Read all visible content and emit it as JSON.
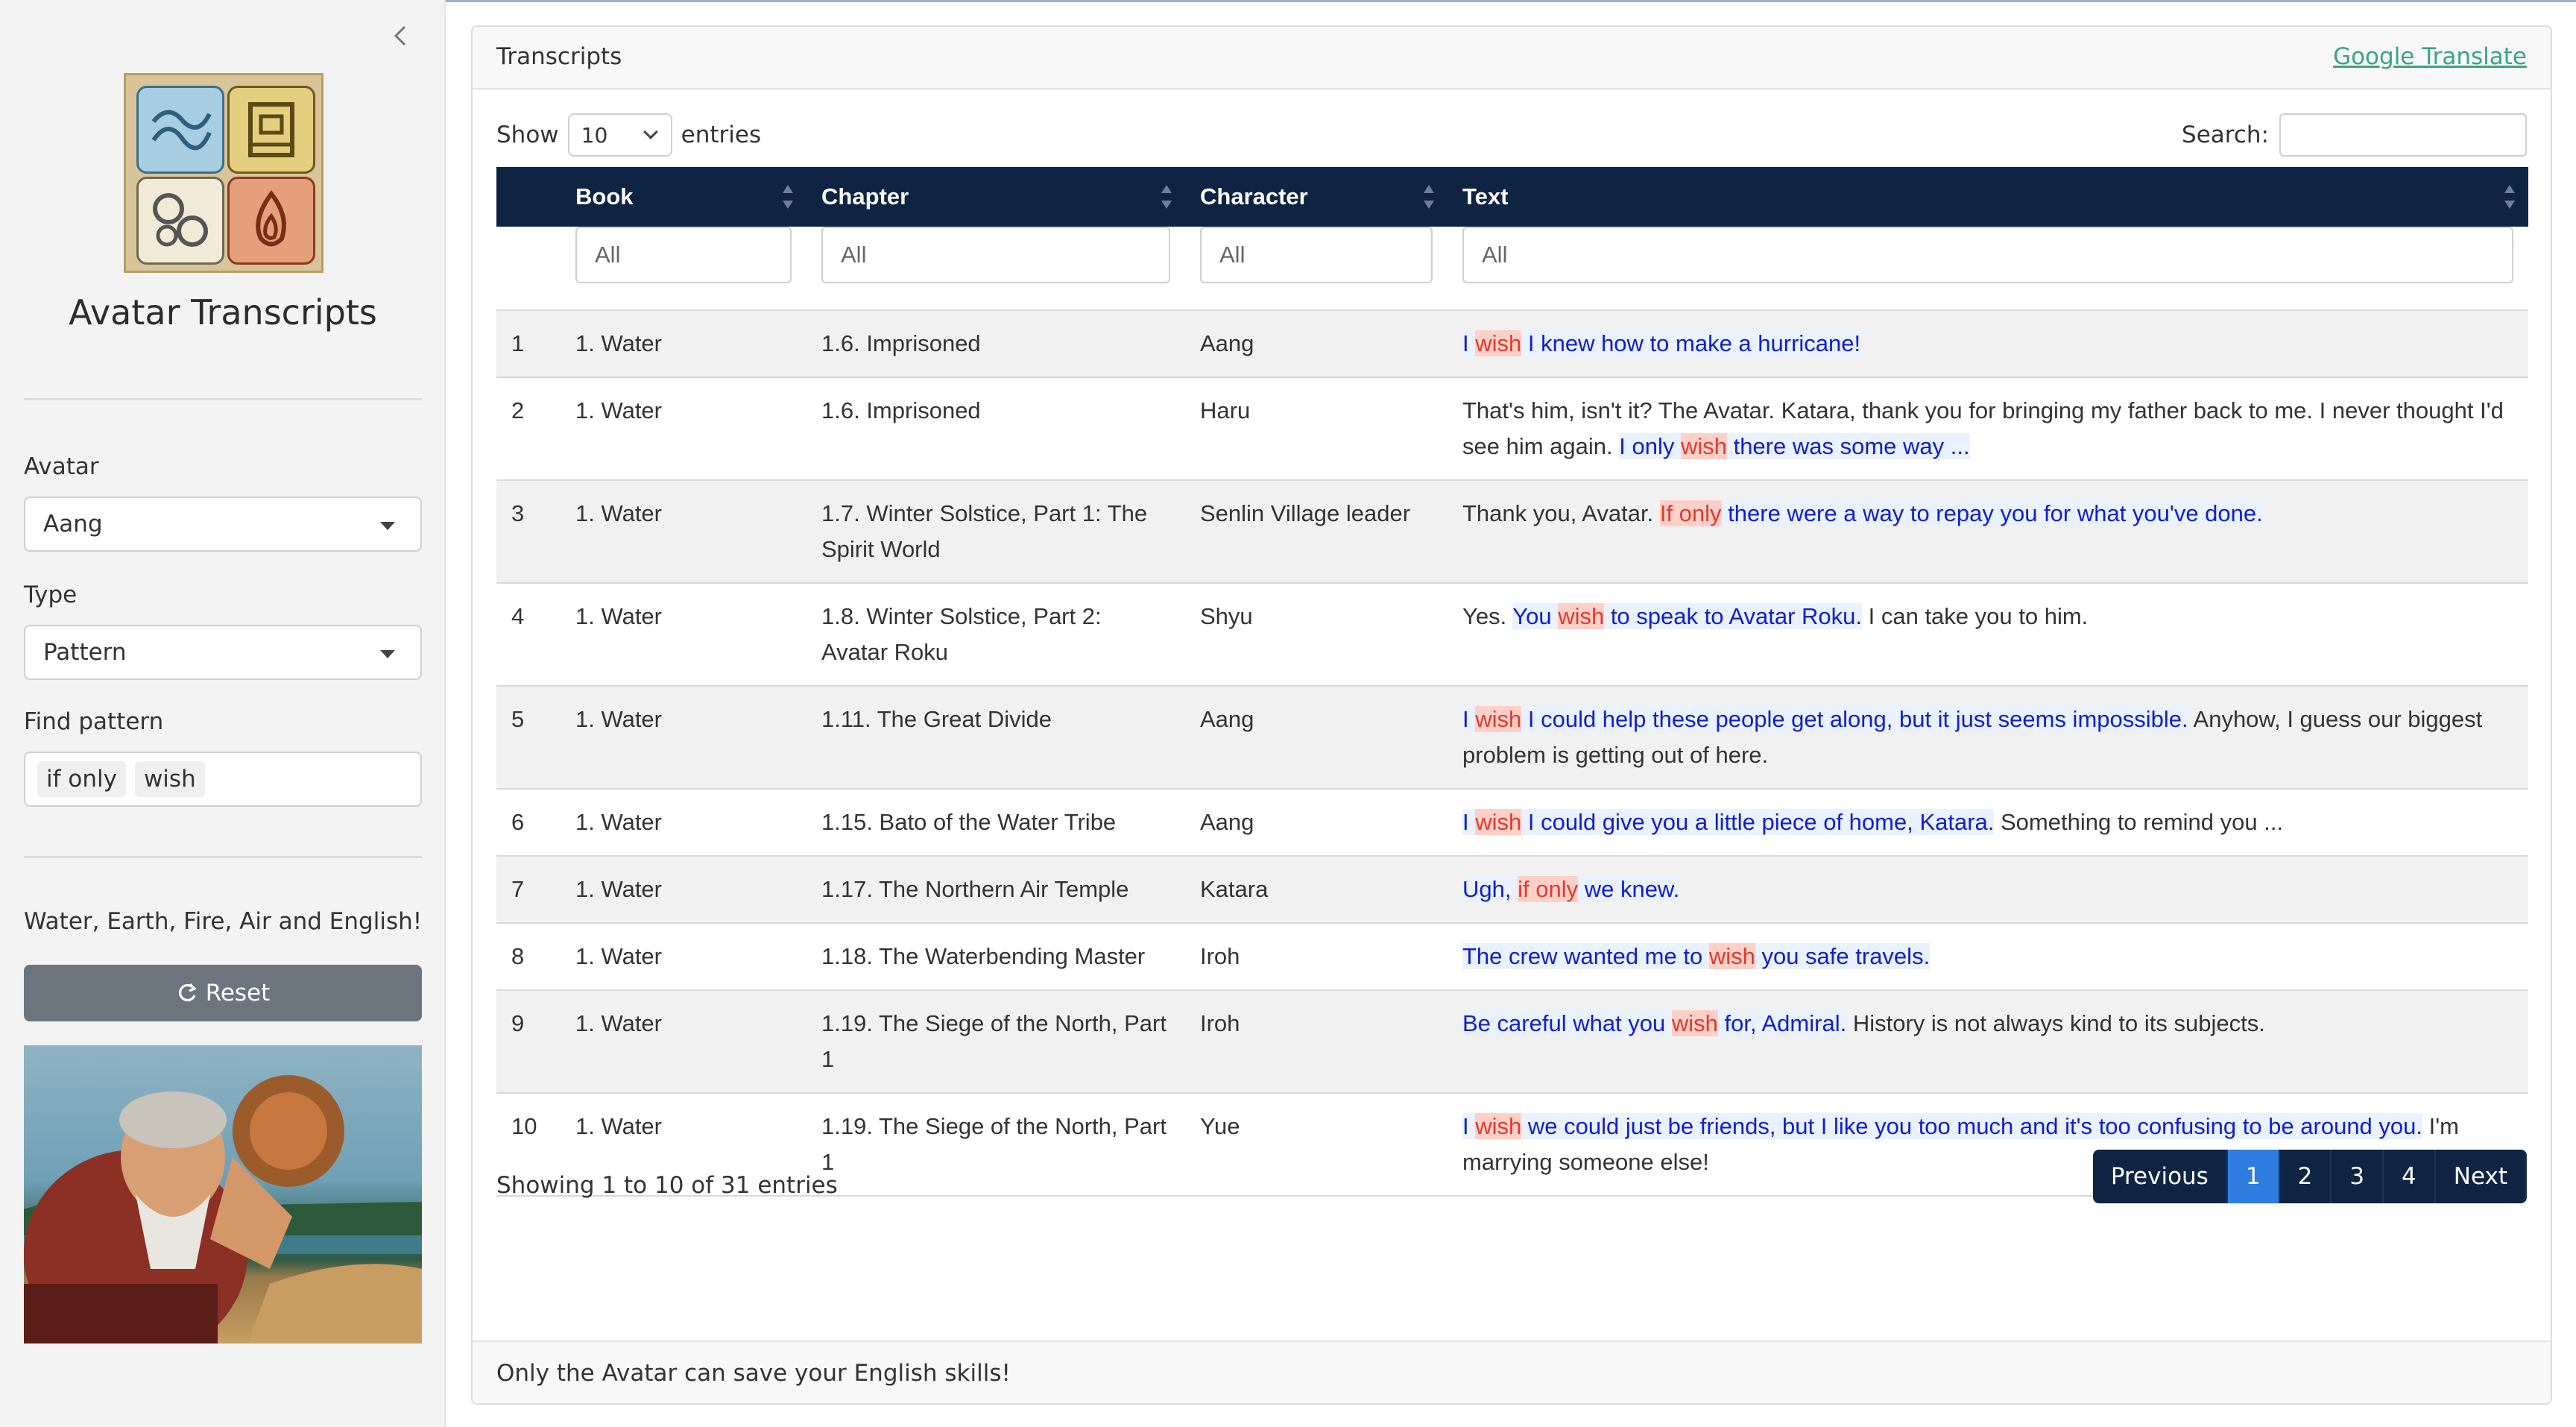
{
  "sidebar": {
    "app_title": "Avatar Transcripts",
    "avatar_label": "Avatar",
    "avatar_value": "Aang",
    "type_label": "Type",
    "type_value": "Pattern",
    "find_label": "Find pattern",
    "patterns": [
      "if only",
      "wish"
    ],
    "tagline": "Water, Earth, Fire, Air and English!",
    "reset_label": "Reset"
  },
  "card": {
    "title": "Transcripts",
    "translate_link": "Google Translate",
    "footer": "Only the Avatar can save your English skills!"
  },
  "controls": {
    "show_label": "Show",
    "page_length": "10",
    "entries_label": "entries",
    "search_label": "Search:"
  },
  "table": {
    "headers": [
      "Book",
      "Chapter",
      "Character",
      "Text"
    ],
    "filter_placeholder": "All",
    "rows": [
      {
        "n": "1",
        "book": "1. Water",
        "chapter": "1.6. Imprisoned",
        "character": "Aang",
        "segments": [
          {
            "t": "I ",
            "s": "hl"
          },
          {
            "t": "wish",
            "s": "kw"
          },
          {
            "t": " I knew how to make a hurricane!",
            "s": "hl"
          }
        ]
      },
      {
        "n": "2",
        "book": "1. Water",
        "chapter": "1.6. Imprisoned",
        "character": "Haru",
        "segments": [
          {
            "t": "That's him, isn't it? The Avatar. Katara, thank you for bringing my father back to me. I never thought I'd see him again. ",
            "s": ""
          },
          {
            "t": "I only ",
            "s": "hl"
          },
          {
            "t": "wish",
            "s": "kw"
          },
          {
            "t": " there was some way ...",
            "s": "hl"
          }
        ]
      },
      {
        "n": "3",
        "book": "1. Water",
        "chapter": "1.7. Winter Solstice, Part 1: The Spirit World",
        "character": "Senlin Village leader",
        "segments": [
          {
            "t": "Thank you, Avatar. ",
            "s": ""
          },
          {
            "t": "If only",
            "s": "kw"
          },
          {
            "t": " there were a way to repay you for what you've done.",
            "s": "hl"
          }
        ]
      },
      {
        "n": "4",
        "book": "1. Water",
        "chapter": "1.8. Winter Solstice, Part 2: Avatar Roku",
        "character": "Shyu",
        "segments": [
          {
            "t": "Yes. ",
            "s": ""
          },
          {
            "t": "You ",
            "s": "hl"
          },
          {
            "t": "wish",
            "s": "kw"
          },
          {
            "t": " to speak to Avatar Roku.",
            "s": "hl"
          },
          {
            "t": " I can take you to him.",
            "s": ""
          }
        ]
      },
      {
        "n": "5",
        "book": "1. Water",
        "chapter": "1.11. The Great Divide",
        "character": "Aang",
        "segments": [
          {
            "t": "I ",
            "s": "hl"
          },
          {
            "t": "wish",
            "s": "kw"
          },
          {
            "t": " I could help these people get along, but it just seems impossible.",
            "s": "hl"
          },
          {
            "t": " Anyhow, I guess our biggest problem is getting out of here.",
            "s": ""
          }
        ]
      },
      {
        "n": "6",
        "book": "1. Water",
        "chapter": "1.15. Bato of the Water Tribe",
        "character": "Aang",
        "segments": [
          {
            "t": "I ",
            "s": "hl"
          },
          {
            "t": "wish",
            "s": "kw"
          },
          {
            "t": " I could give you a little piece of home, Katara.",
            "s": "hl"
          },
          {
            "t": " Something to remind you ...",
            "s": ""
          }
        ]
      },
      {
        "n": "7",
        "book": "1. Water",
        "chapter": "1.17. The Northern Air Temple",
        "character": "Katara",
        "segments": [
          {
            "t": "Ugh, ",
            "s": "hl"
          },
          {
            "t": "if only",
            "s": "kw"
          },
          {
            "t": " we knew.",
            "s": "hl"
          }
        ]
      },
      {
        "n": "8",
        "book": "1. Water",
        "chapter": "1.18. The Waterbending Master",
        "character": "Iroh",
        "segments": [
          {
            "t": "The crew wanted me to ",
            "s": "hl"
          },
          {
            "t": "wish",
            "s": "kw"
          },
          {
            "t": " you safe travels.",
            "s": "hl"
          }
        ]
      },
      {
        "n": "9",
        "book": "1. Water",
        "chapter": "1.19. The Siege of the North, Part 1",
        "character": "Iroh",
        "segments": [
          {
            "t": "Be careful what you ",
            "s": "hl"
          },
          {
            "t": "wish",
            "s": "kw"
          },
          {
            "t": " for, Admiral.",
            "s": "hl"
          },
          {
            "t": " History is not always kind to its subjects.",
            "s": ""
          }
        ]
      },
      {
        "n": "10",
        "book": "1. Water",
        "chapter": "1.19. The Siege of the North, Part 1",
        "character": "Yue",
        "segments": [
          {
            "t": "I ",
            "s": "hl"
          },
          {
            "t": "wish",
            "s": "kw"
          },
          {
            "t": " we could just be friends, but I like you too much and it's too confusing to be around you.",
            "s": "hl"
          },
          {
            "t": " I'm marrying someone else!",
            "s": ""
          }
        ]
      }
    ]
  },
  "info": "Showing 1 to 10 of 31 entries",
  "pagination": {
    "previous": "Previous",
    "pages": [
      "1",
      "2",
      "3",
      "4"
    ],
    "active": "1",
    "next": "Next"
  },
  "colors": {
    "header_navy": "#0f2443",
    "pagination_active": "#2f7de1",
    "match_text": "#1020c8",
    "keyword_text": "#e03a2f",
    "reset_button": "#6c757d",
    "link_green": "#3aa67a"
  },
  "icons": {
    "collapse": "chevron-left-icon",
    "dropdown": "caret-down-icon",
    "reset": "refresh-icon",
    "sort": "sort-icon"
  }
}
